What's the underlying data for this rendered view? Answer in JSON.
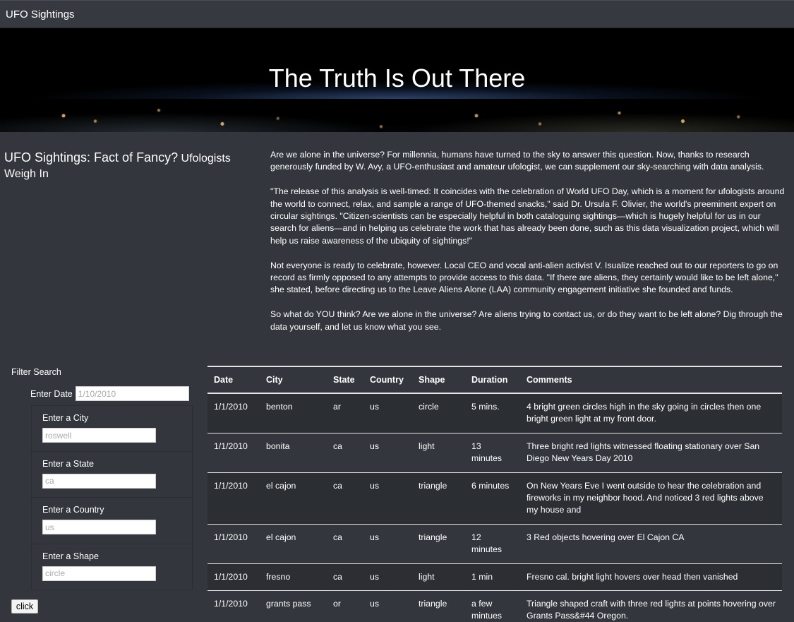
{
  "navbar": {
    "brand": "UFO Sightings"
  },
  "hero": {
    "title": "The Truth Is Out There"
  },
  "heading": {
    "main": "UFO Sightings: Fact of Fancy?",
    "sub": "Ufologists Weigh In"
  },
  "article": {
    "paragraphs": [
      "Are we alone in the universe? For millennia, humans have turned to the sky to answer this question. Now, thanks to research generously funded by W. Avy, a UFO-enthusiast and amateur ufologist, we can supplement our sky-searching with data analysis.",
      "\"The release of this analysis is well-timed: It coincides with the celebration of World UFO Day, which is a moment for ufologists around the world to connect, relax, and sample a range of UFO-themed snacks,\" said Dr. Ursula F. Olivier, the world's preeminent expert on circular sightings. \"Citizen-scientists can be especially helpful in both cataloguing sightings—which is hugely helpful for us in our search for aliens—and in helping us celebrate the work that has already been done, such as this data visualization project, which will help us raise awareness of the ubiquity of sightings!\"",
      "Not everyone is ready to celebrate, however. Local CEO and vocal anti-alien activist V. Isualize reached out to our reporters to go on record as firmly opposed to any attempts to provide access to this data. \"If there are aliens, they certainly would like to be left alone,\" she stated, before directing us to the Leave Aliens Alone (LAA) community engagement initiative she founded and funds.",
      "So what do YOU think? Are we alone in the universe? Are aliens trying to contact us, or do they want to be left alone? Dig through the data yourself, and let us know what you see."
    ]
  },
  "filters": {
    "title": "Filter Search",
    "date": {
      "label": "Enter Date",
      "placeholder": "1/10/2010"
    },
    "city": {
      "label": "Enter a City",
      "placeholder": "roswell"
    },
    "state": {
      "label": "Enter a State",
      "placeholder": "ca"
    },
    "country": {
      "label": "Enter a Country",
      "placeholder": "us"
    },
    "shape": {
      "label": "Enter a Shape",
      "placeholder": "circle"
    },
    "button_label": "click"
  },
  "table": {
    "headers": [
      "Date",
      "City",
      "State",
      "Country",
      "Shape",
      "Duration",
      "Comments"
    ],
    "rows": [
      [
        "1/1/2010",
        "benton",
        "ar",
        "us",
        "circle",
        "5 mins.",
        "4 bright green circles high in the sky going in circles then one bright green light at my front door."
      ],
      [
        "1/1/2010",
        "bonita",
        "ca",
        "us",
        "light",
        "13 minutes",
        "Three bright red lights witnessed floating stationary over San Diego New Years Day 2010"
      ],
      [
        "1/1/2010",
        "el cajon",
        "ca",
        "us",
        "triangle",
        "6 minutes",
        "On New Years Eve I went outside to hear the celebration and fireworks in my neighbor hood. And noticed 3 red lights above my house and"
      ],
      [
        "1/1/2010",
        "el cajon",
        "ca",
        "us",
        "triangle",
        "12 minutes",
        "3 Red objects hovering over El Cajon CA"
      ],
      [
        "1/1/2010",
        "fresno",
        "ca",
        "us",
        "light",
        "1 min",
        "Fresno cal. bright light hovers over head then vanished"
      ],
      [
        "1/1/2010",
        "grants pass",
        "or",
        "us",
        "triangle",
        "a few mintues",
        "Triangle shaped craft with three red lights at points hovering over Grants Pass&#44 Oregon."
      ]
    ]
  }
}
